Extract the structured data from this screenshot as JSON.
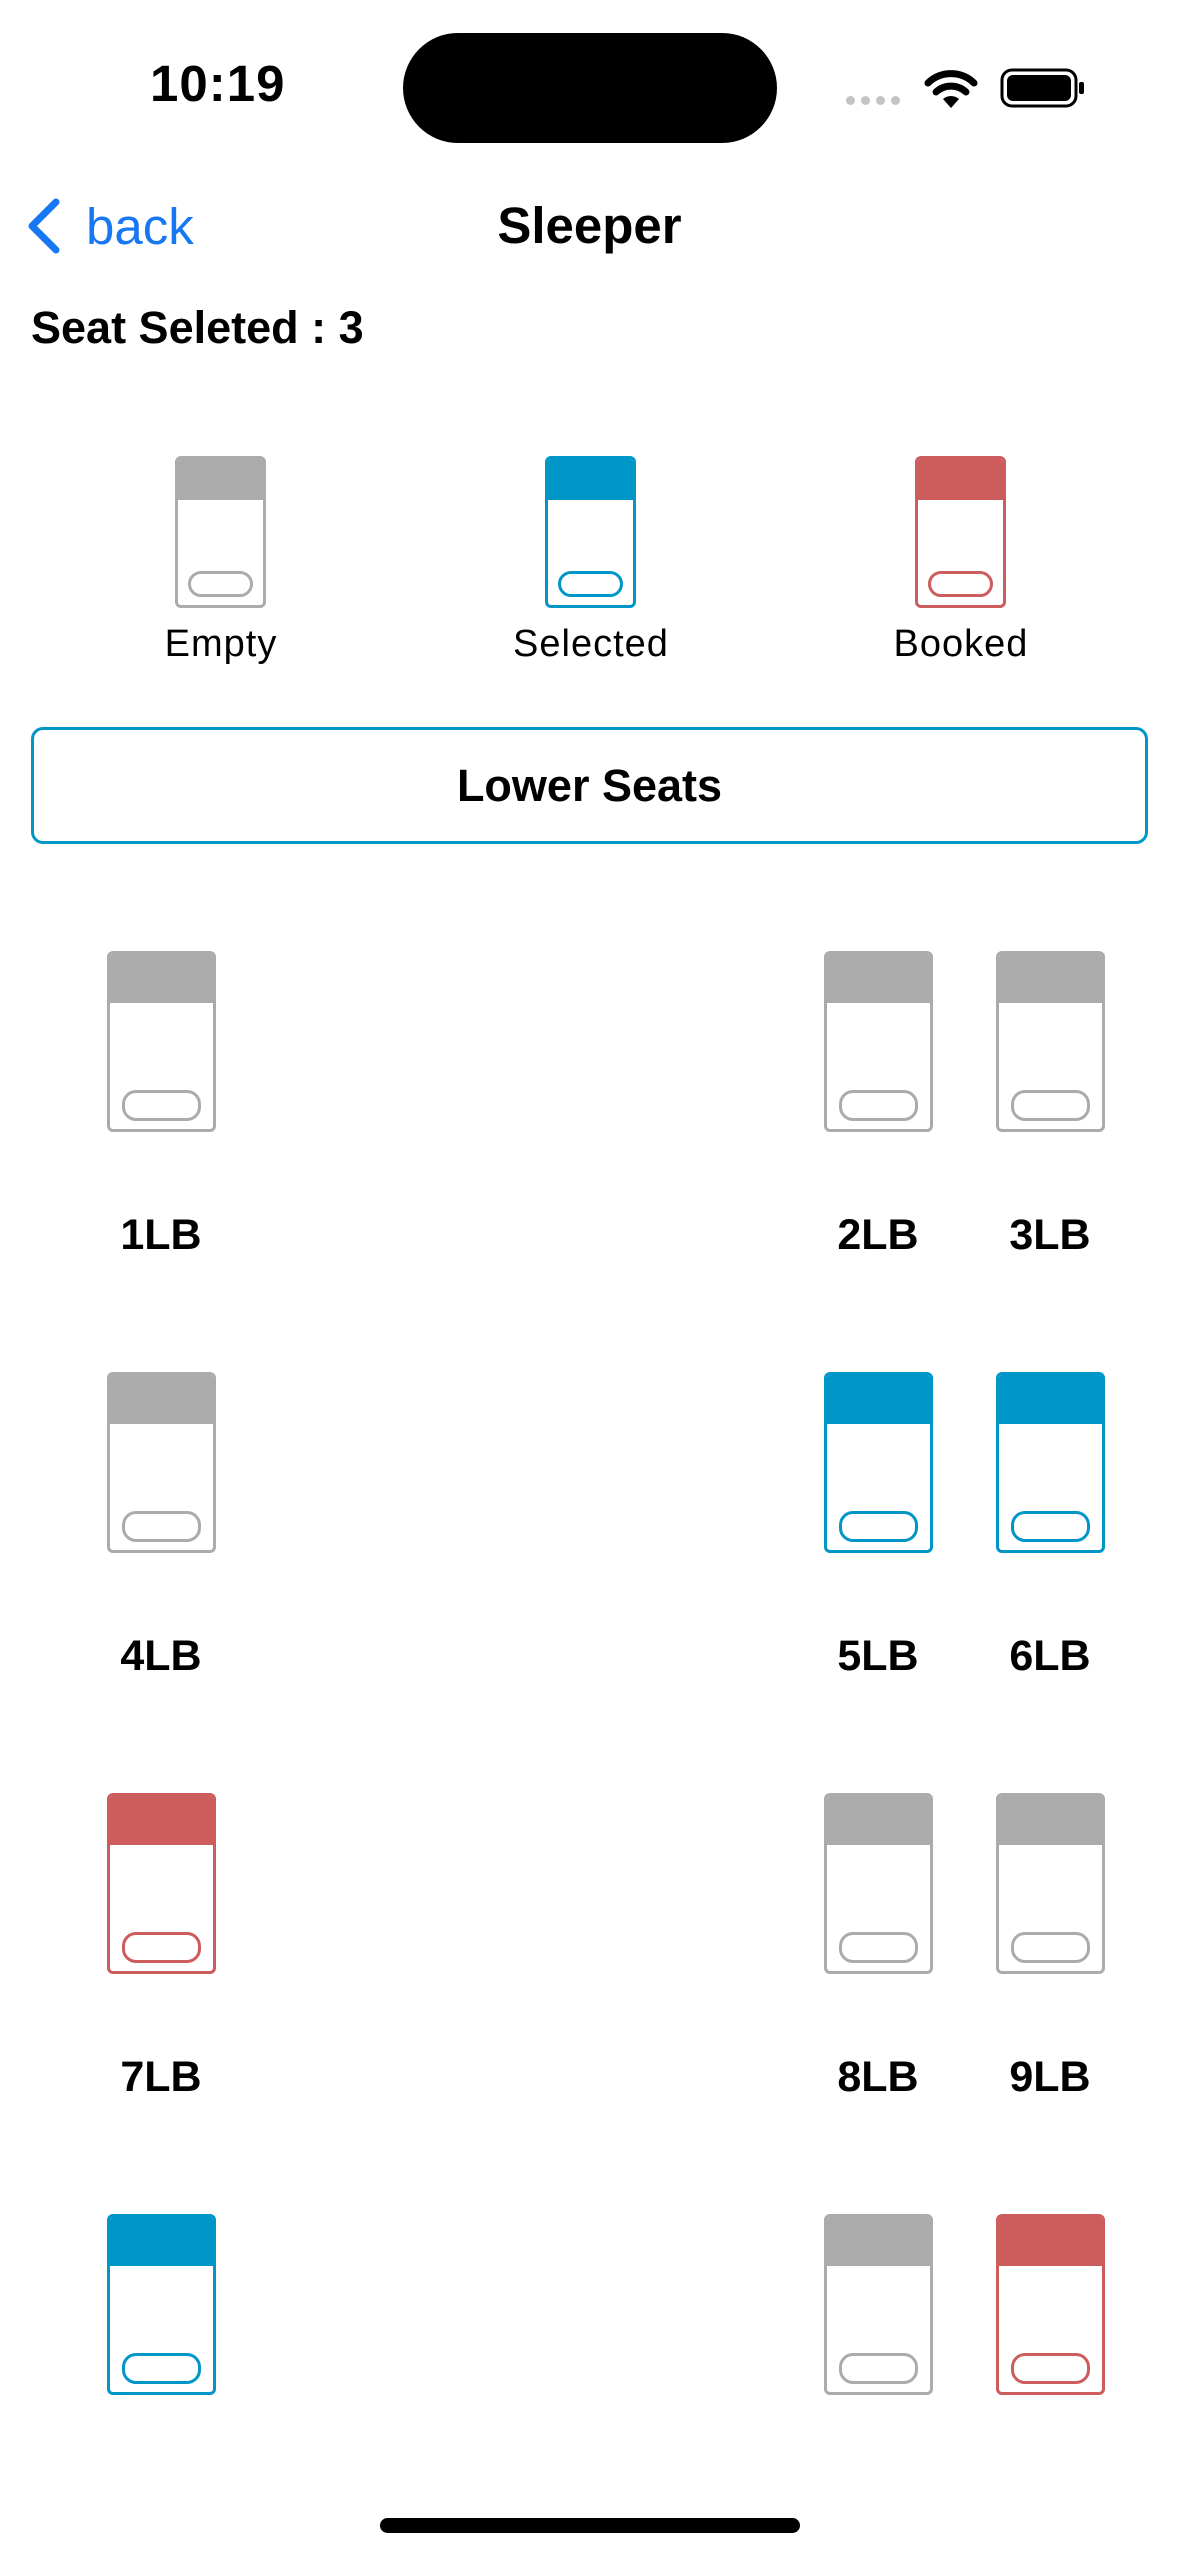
{
  "status_bar": {
    "time": "10:19"
  },
  "nav": {
    "back_label": "back",
    "title": "Sleeper"
  },
  "seat_count_text": "Seat Seleted : 3",
  "colors": {
    "empty": "#ababab",
    "selected": "#0096c7",
    "booked": "#cd5c5c",
    "link": "#1877f2"
  },
  "legend": [
    {
      "label": "Empty",
      "status": "empty"
    },
    {
      "label": "Selected",
      "status": "selected"
    },
    {
      "label": "Booked",
      "status": "booked"
    }
  ],
  "section": {
    "title": "Lower Seats"
  },
  "seats": [
    {
      "label": "1LB",
      "status": "empty"
    },
    {
      "label": "2LB",
      "status": "empty"
    },
    {
      "label": "3LB",
      "status": "empty"
    },
    {
      "label": "4LB",
      "status": "empty"
    },
    {
      "label": "5LB",
      "status": "selected"
    },
    {
      "label": "6LB",
      "status": "selected"
    },
    {
      "label": "7LB",
      "status": "booked"
    },
    {
      "label": "8LB",
      "status": "empty"
    },
    {
      "label": "9LB",
      "status": "empty"
    },
    {
      "label": "",
      "status": "selected"
    },
    {
      "label": "",
      "status": "empty"
    },
    {
      "label": "",
      "status": "booked"
    }
  ]
}
